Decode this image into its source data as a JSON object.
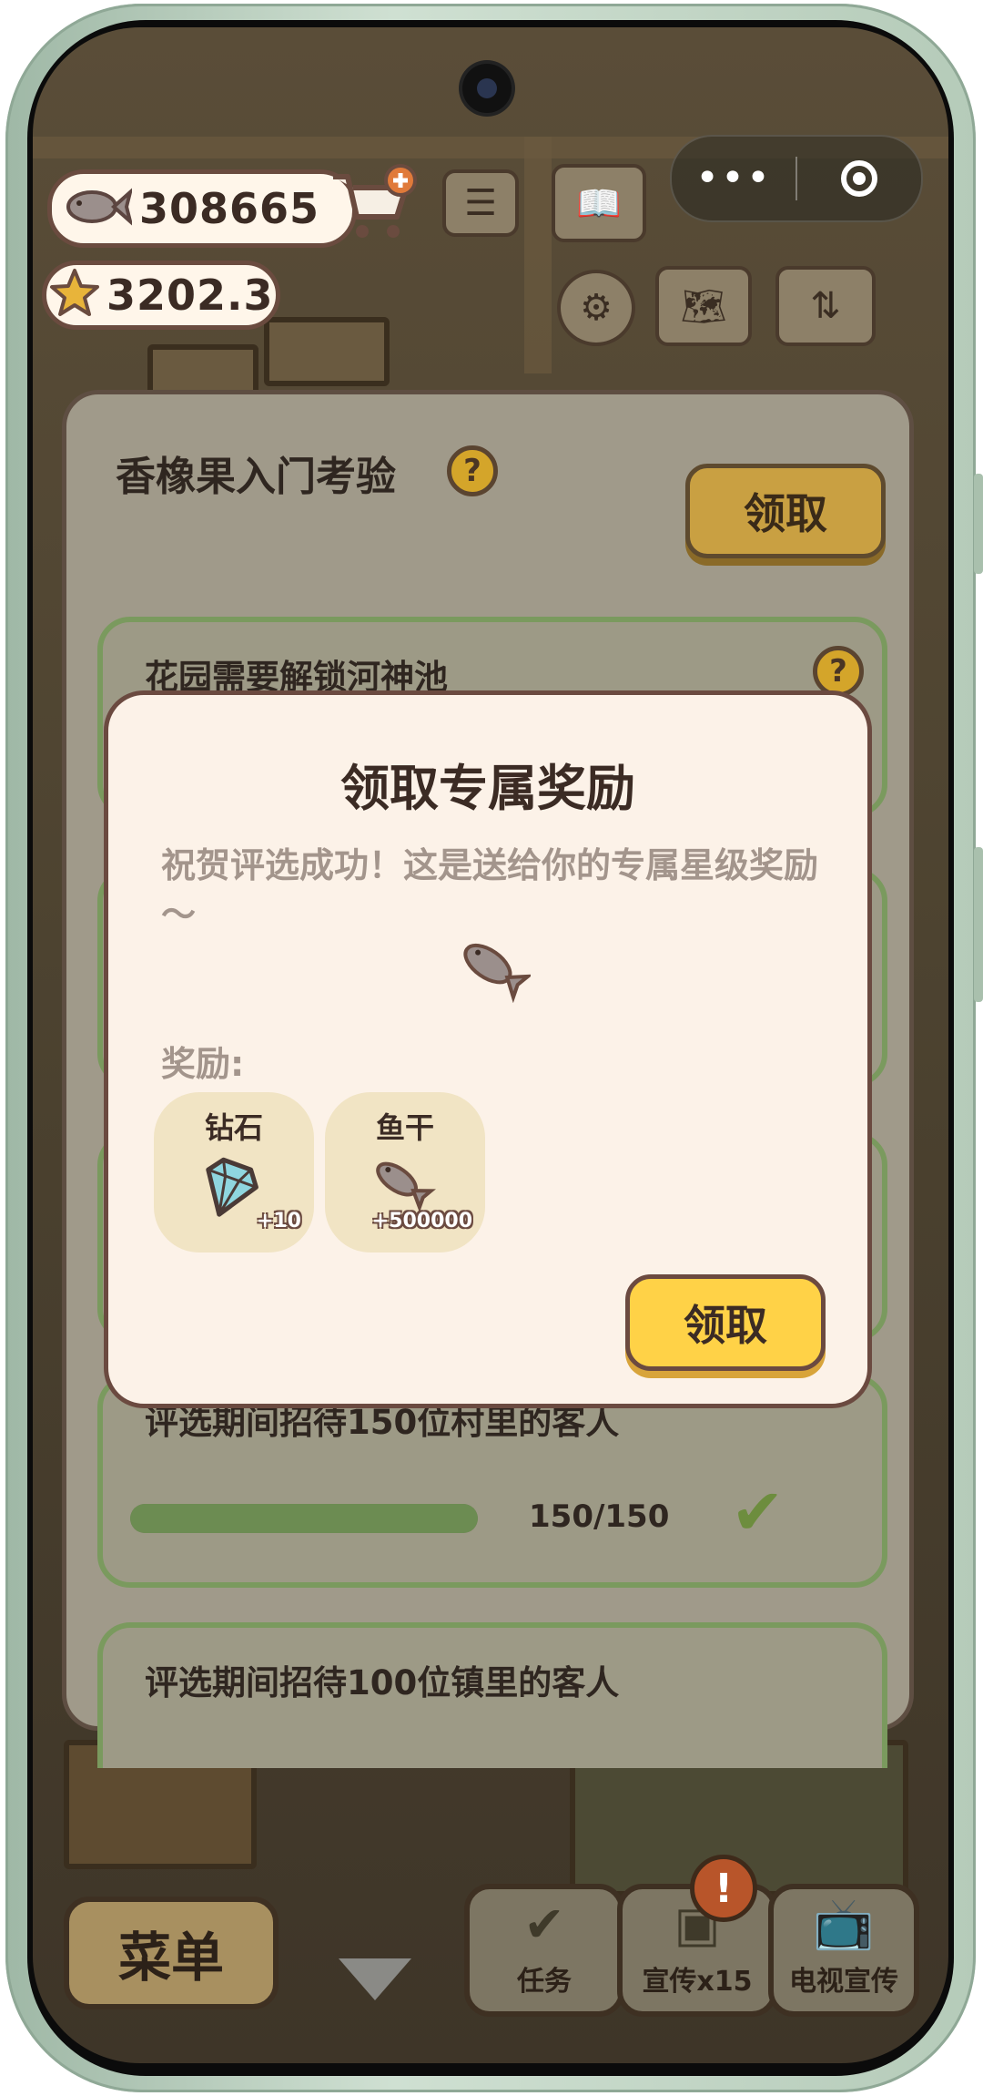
{
  "hud": {
    "fish_count": "308665",
    "star_count": "3202.3",
    "fish_icon": "fish-icon",
    "star_icon": "star-icon",
    "cart_icon": "shopping-cart-plus-icon",
    "more_icon": "•••",
    "close_icon": "target-close-icon"
  },
  "panel": {
    "title": "香橡果入门考验",
    "help": "?",
    "claim_label": "领取",
    "tasks": [
      {
        "title": "花园需要解锁河神池",
        "help": "?"
      },
      {
        "title": "评选期间招待150位村里的客人",
        "progress_text": "150/150",
        "progress": 1.0,
        "done": "✔"
      },
      {
        "title": "评选期间招待100位镇里的客人"
      }
    ]
  },
  "modal": {
    "title": "领取专属奖励",
    "message": "祝贺评选成功！这是送给你的专属星级奖励～",
    "rewards_label": "奖励:",
    "rewards": [
      {
        "name": "钻石",
        "amount": "+10",
        "icon": "diamond-icon"
      },
      {
        "name": "鱼干",
        "amount": "+500000",
        "icon": "fish-icon"
      }
    ],
    "claim_label": "领取"
  },
  "bottom": {
    "menu_label": "菜单",
    "tasks_label": "任务",
    "promo_label": "宣传x15",
    "tv_label": "电视宣传",
    "alert": "!"
  },
  "colors": {
    "accent_yellow": "#ffd247",
    "modal_bg": "#fcf2e8",
    "border_brown": "#6b4a40",
    "task_green": "#7a9a5e"
  }
}
